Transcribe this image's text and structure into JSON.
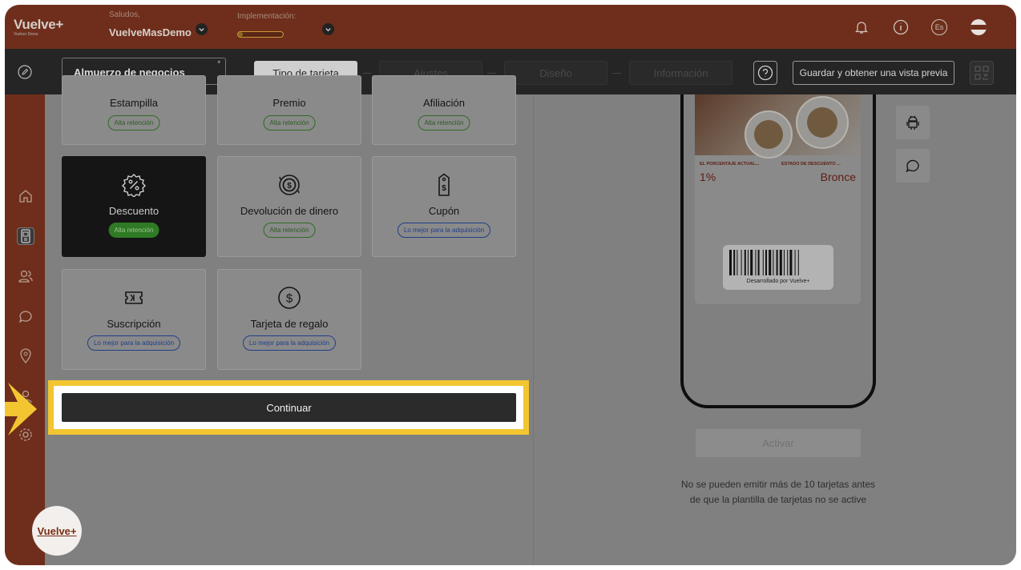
{
  "brand": {
    "logo_text": "Vuelve+",
    "logo_sub": "Vuelve+ Demo"
  },
  "topbar": {
    "greeting_label": "Saludos,",
    "account_name": "VuelveMasDemo",
    "implementation_label": "Implementación:",
    "implementation_progress": 0.1,
    "language": "Es",
    "avatar_text": "Vuelve+"
  },
  "editor": {
    "card_name": "Almuerzo de negocios",
    "required_mark": "*",
    "steps": [
      {
        "label": "Tipo de tarjeta",
        "active": true
      },
      {
        "label": "Ajustes",
        "active": false
      },
      {
        "label": "Diseño",
        "active": false
      },
      {
        "label": "Información",
        "active": false
      }
    ],
    "preview_button": "Guardar y obtener una vista previa"
  },
  "card_types": [
    {
      "title": "Estampilla",
      "badge": "Alta retención",
      "badge_type": "green",
      "icon": "stamp-icon"
    },
    {
      "title": "Premio",
      "badge": "Alta retención",
      "badge_type": "green",
      "icon": "prize-icon"
    },
    {
      "title": "Afiliación",
      "badge": "Alta retención",
      "badge_type": "green",
      "icon": "membership-icon"
    },
    {
      "title": "Descuento",
      "badge": "Alta retención",
      "badge_type": "filled",
      "icon": "discount-icon",
      "selected": true
    },
    {
      "title": "Devolución de dinero",
      "badge": "Alta retención",
      "badge_type": "green",
      "icon": "cashback-icon"
    },
    {
      "title": "Cupón",
      "badge": "Lo mejor para la adquisición",
      "badge_type": "blue",
      "icon": "coupon-icon"
    },
    {
      "title": "Suscripción",
      "badge": "Lo mejor para la adquisición",
      "badge_type": "blue",
      "icon": "subscription-icon"
    },
    {
      "title": "Tarjeta de regalo",
      "badge": "Lo mejor para la adquisición",
      "badge_type": "blue",
      "icon": "gift-card-icon"
    }
  ],
  "continue_button": "Continuar",
  "pass_preview": {
    "field1_label": "EL PORCENTAJE ACTUAL...",
    "field1_value": "1%",
    "field2_label": "ESTADO DE DESCUENTO ...",
    "field2_value": "Bronce",
    "barcode_caption": "Desarrollado por Vuelve+"
  },
  "activate": {
    "button": "Activar",
    "note": "No se pueden emitir más de 10 tarjetas antes de que la plantilla de tarjetas no se active"
  },
  "colors": {
    "brand": "#6e2e1b",
    "highlight": "#f2c531",
    "editor_bar": "#252525"
  }
}
